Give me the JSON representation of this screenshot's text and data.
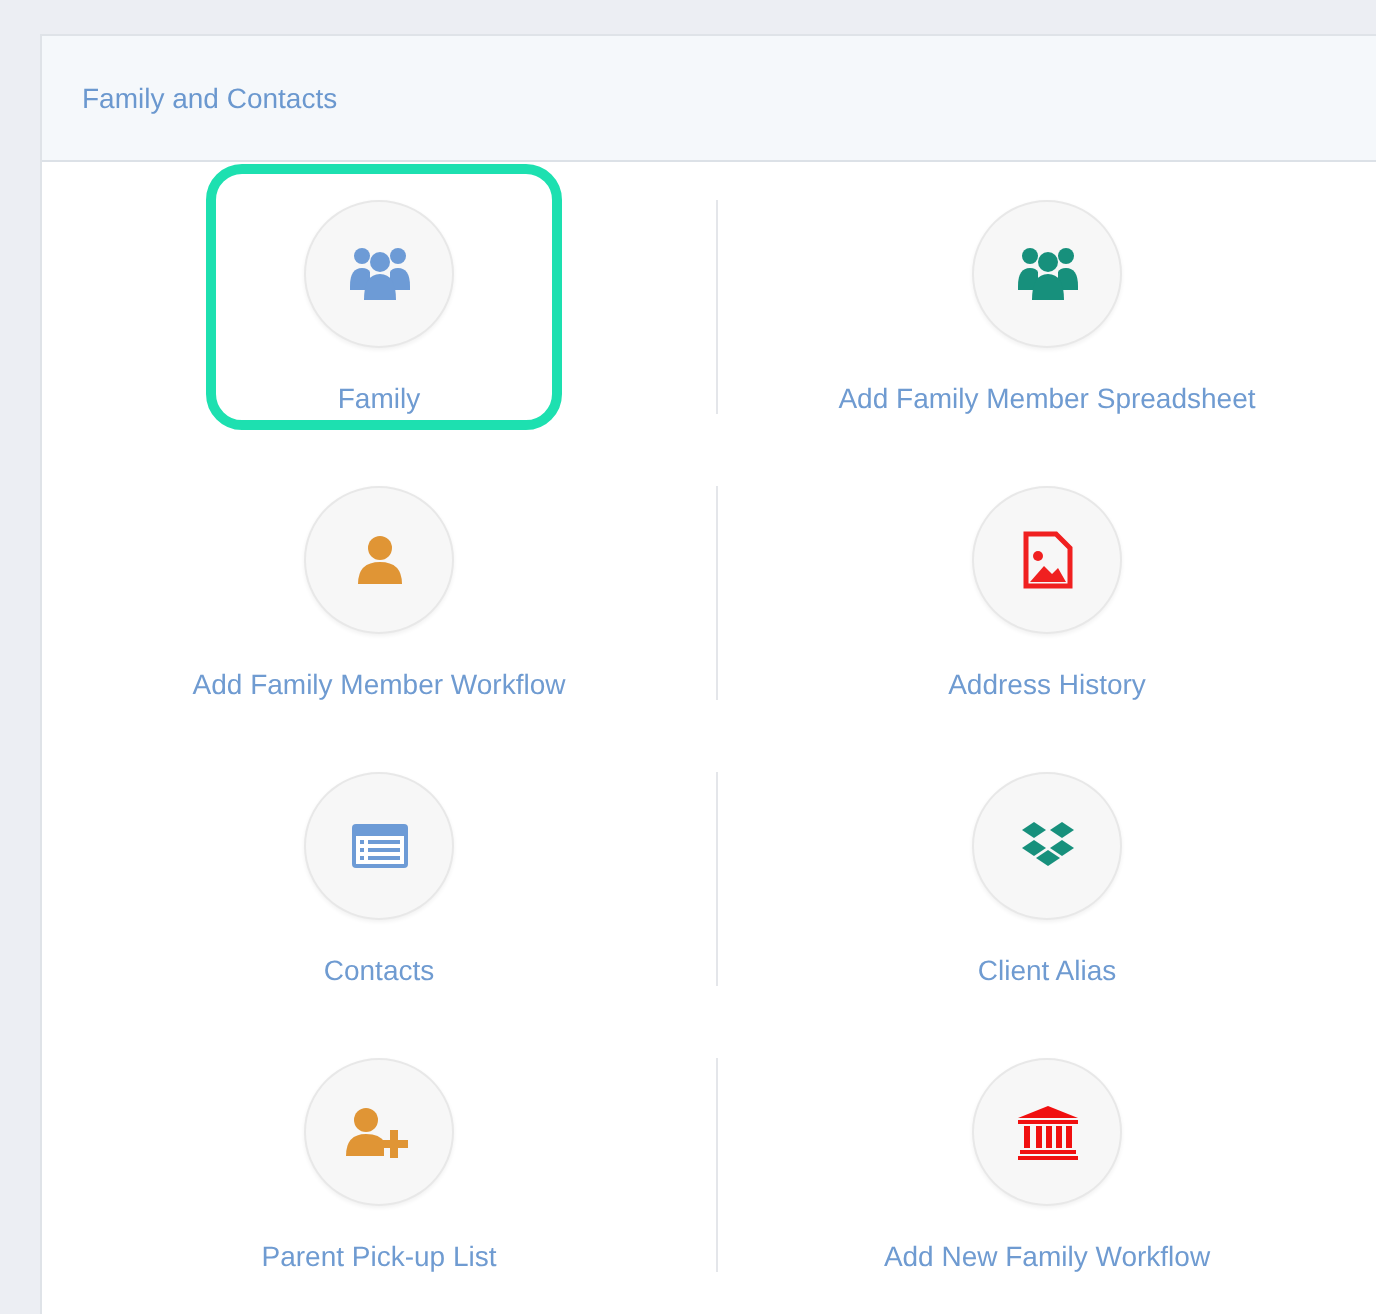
{
  "panel": {
    "title": "Family and Contacts"
  },
  "items": [
    {
      "label": "Family",
      "kind": "group",
      "highlighted": true
    },
    {
      "label": "Add Family Member Spreadsheet",
      "kind": "group-teal",
      "highlighted": false
    },
    {
      "label": "Add Family Member Workflow",
      "kind": "person",
      "highlighted": false
    },
    {
      "label": "Address History",
      "kind": "image-file",
      "highlighted": false
    },
    {
      "label": "Contacts",
      "kind": "list-card",
      "highlighted": false
    },
    {
      "label": "Client Alias",
      "kind": "boxes",
      "highlighted": false
    },
    {
      "label": "Parent Pick-up List",
      "kind": "person-add",
      "highlighted": false
    },
    {
      "label": "Add New Family Workflow",
      "kind": "bank",
      "highlighted": false
    }
  ]
}
